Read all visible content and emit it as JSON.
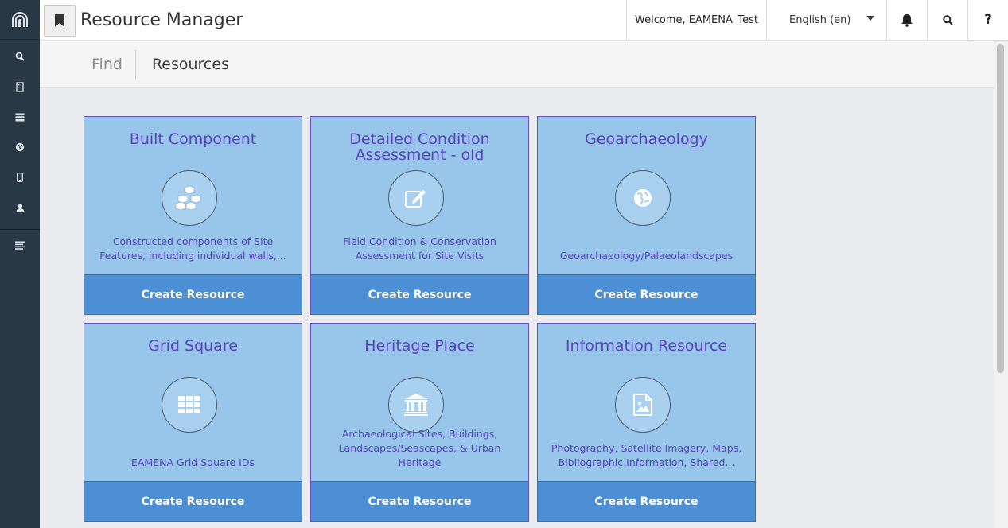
{
  "header": {
    "app_title": "Resource Manager",
    "welcome": "Welcome, EAMENA_Test",
    "language": "English (en)",
    "help": "?"
  },
  "breadcrumb": {
    "find": "Find",
    "current": "Resources"
  },
  "icons": {
    "logo": "arches-logo-icon",
    "sidebar": [
      "search-icon",
      "building-icon",
      "server-icon",
      "globe-icon",
      "mobile-icon",
      "user-icon",
      "menu-icon"
    ],
    "header": [
      "bookmark-icon",
      "bell-icon",
      "search-icon"
    ]
  },
  "colors": {
    "sidebar": "#2a3845",
    "card": "#97c6ea",
    "card_text": "#5b3fc0",
    "create_button": "#4c8fd5"
  },
  "cards": [
    {
      "title": "Built Component",
      "icon": "cubes-icon",
      "desc_1": "Constructed components of Site",
      "desc_2": "Features, including individual walls,...",
      "button": "Create Resource"
    },
    {
      "title": "Detailed Condition Assessment - old",
      "icon": "edit-icon",
      "desc_1": "Field Condition & Conservation",
      "desc_2": "Assessment for Site Visits",
      "button": "Create Resource"
    },
    {
      "title": "Geoarchaeology",
      "icon": "globe-icon",
      "desc_1": "",
      "desc_2": "Geoarchaeology/Palaeolandscapes",
      "button": "Create Resource"
    },
    {
      "title": "Grid Square",
      "icon": "grid-icon",
      "desc_1": "",
      "desc_2": "EAMENA Grid Square IDs",
      "button": "Create Resource"
    },
    {
      "title": "Heritage Place",
      "icon": "institution-icon",
      "desc_1": "Archaeological Sites, Buildings,",
      "desc_2": "Landscapes/Seascapes, & Urban Heritage",
      "button": "Create Resource"
    },
    {
      "title": "Information Resource",
      "icon": "file-image-icon",
      "desc_1": "Photography, Satellite Imagery, Maps,",
      "desc_2": "Bibliographic Information, Shared...",
      "button": "Create Resource"
    }
  ]
}
